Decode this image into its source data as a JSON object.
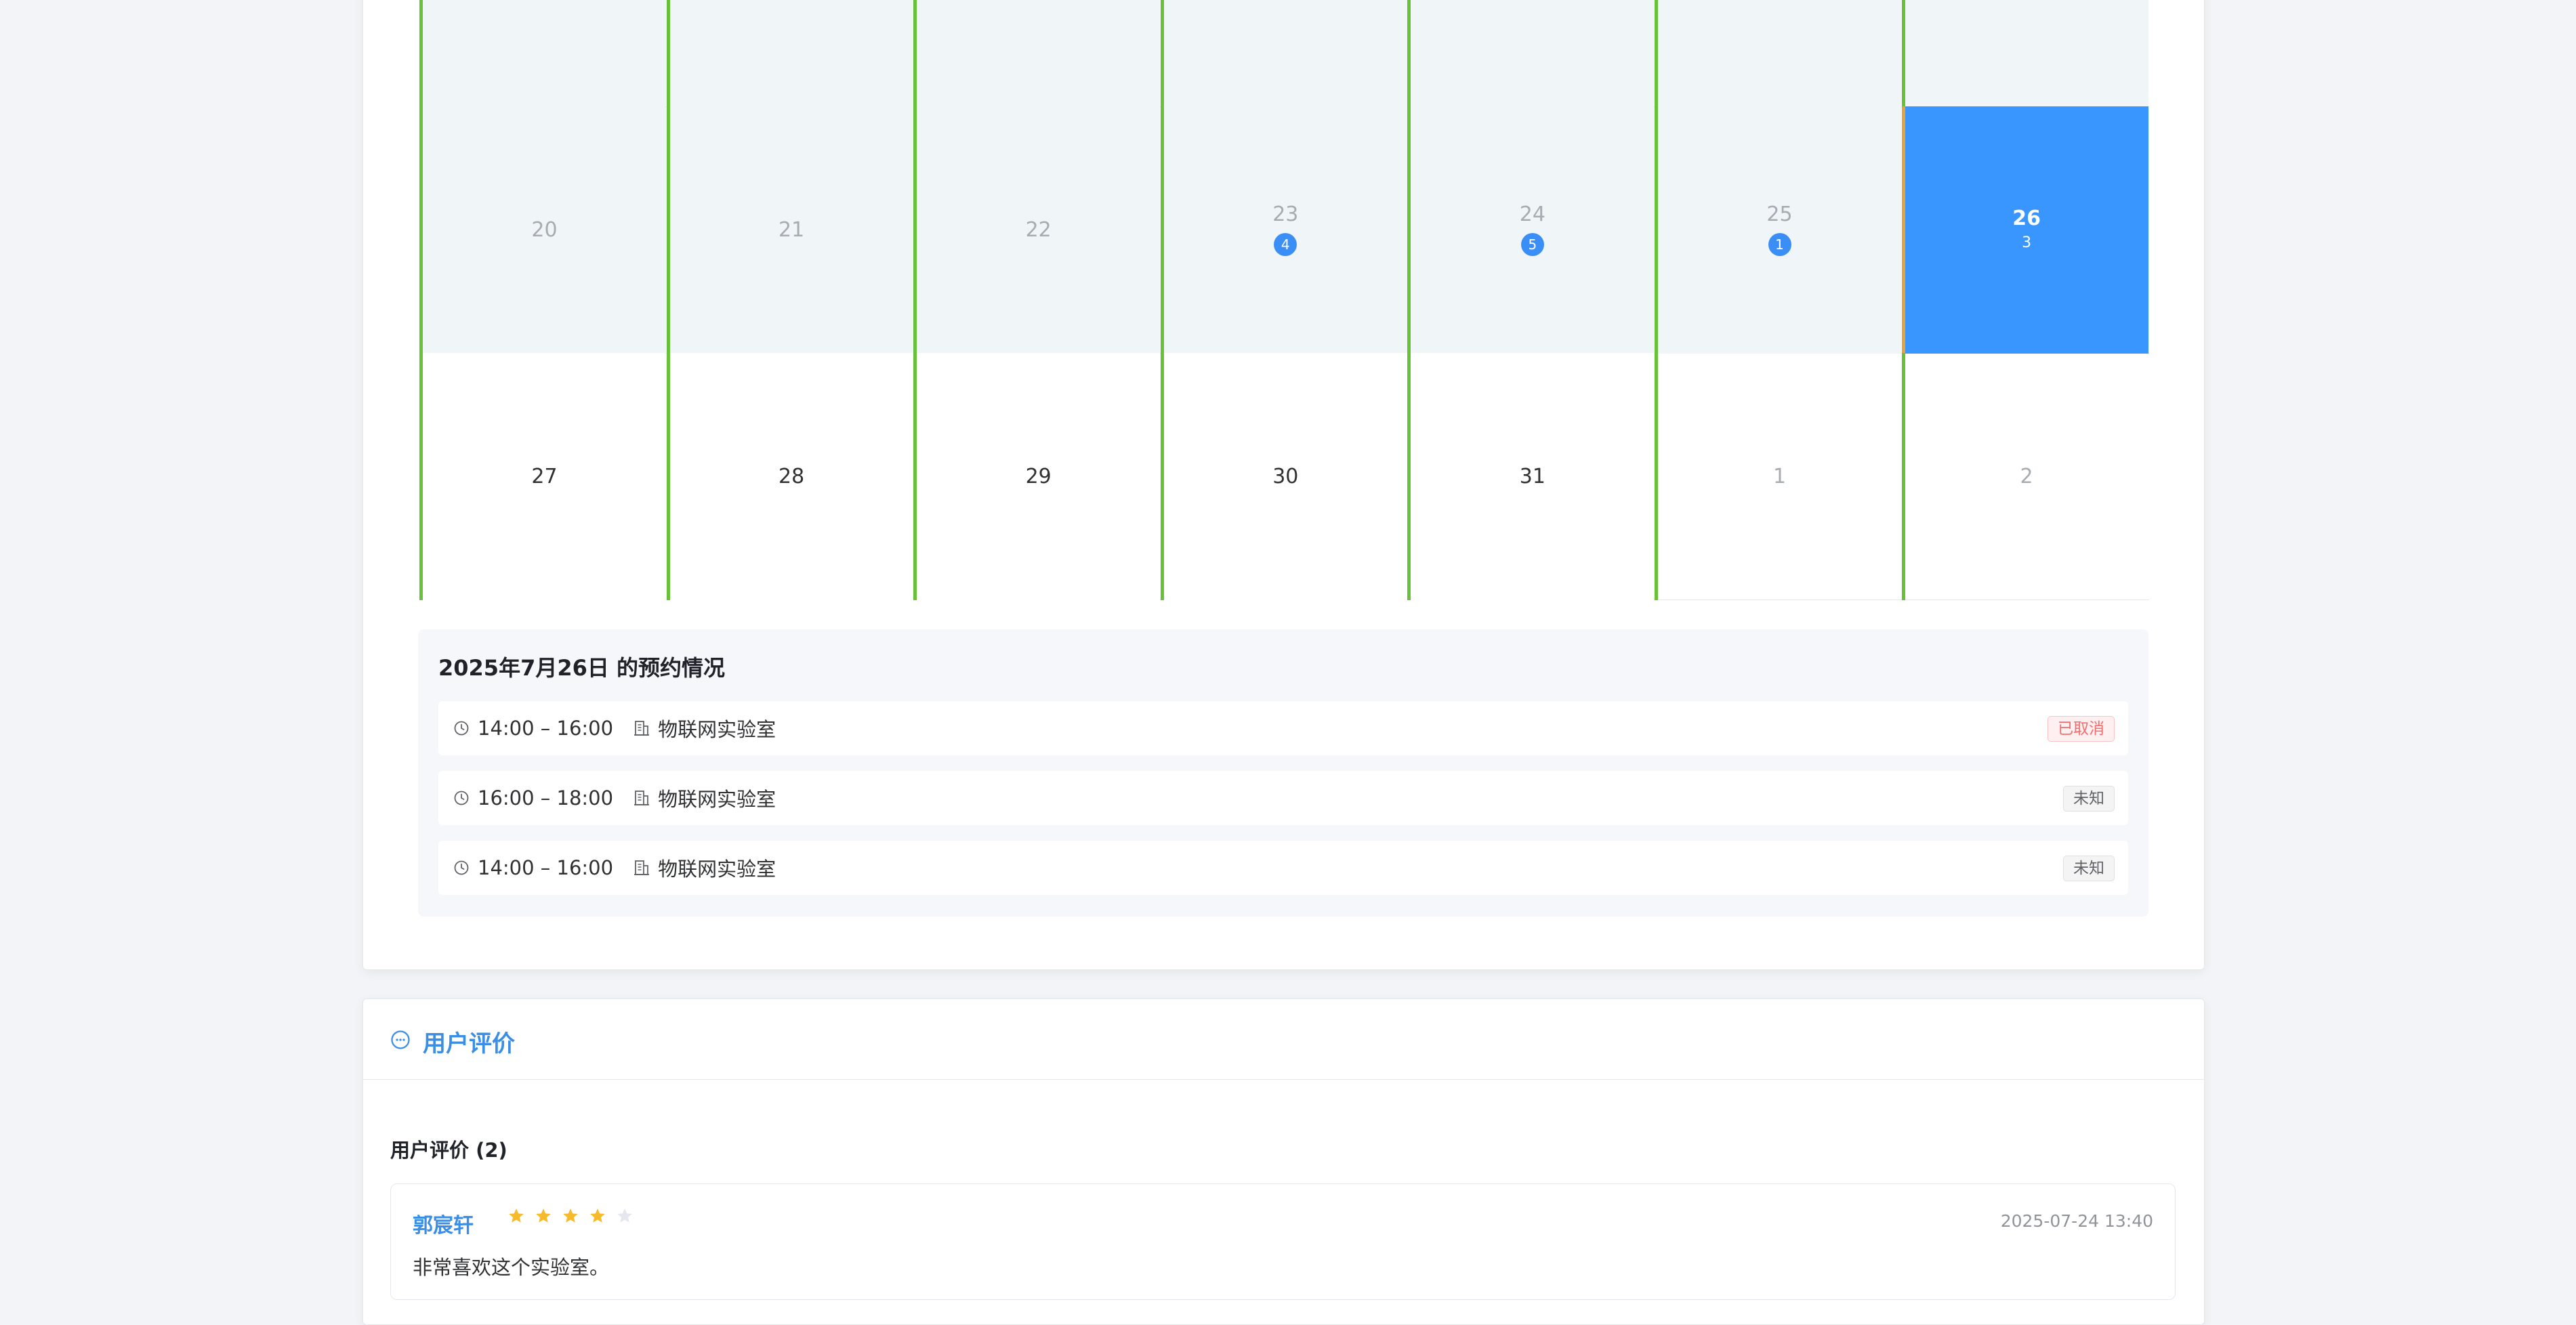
{
  "calendar": {
    "rows": [
      {
        "cells": [
          {
            "day": "",
            "kind": "prev",
            "count": ""
          },
          {
            "day": "",
            "kind": "prev",
            "count": ""
          },
          {
            "day": "",
            "kind": "prev",
            "count": ""
          },
          {
            "day": "",
            "kind": "prev",
            "count": ""
          },
          {
            "day": "",
            "kind": "prev",
            "count": ""
          },
          {
            "day": "",
            "kind": "prev",
            "count": ""
          },
          {
            "day": "",
            "kind": "prev",
            "count": ""
          }
        ]
      },
      {
        "cells": [
          {
            "day": "20",
            "kind": "prev",
            "count": ""
          },
          {
            "day": "21",
            "kind": "prev",
            "count": ""
          },
          {
            "day": "22",
            "kind": "prev",
            "count": ""
          },
          {
            "day": "23",
            "kind": "prev",
            "count": "4"
          },
          {
            "day": "24",
            "kind": "prev",
            "count": "5"
          },
          {
            "day": "25",
            "kind": "prev",
            "count": "1"
          },
          {
            "day": "26",
            "kind": "selected",
            "count": "3"
          }
        ]
      },
      {
        "cells": [
          {
            "day": "27",
            "kind": "cur",
            "count": ""
          },
          {
            "day": "28",
            "kind": "cur",
            "count": ""
          },
          {
            "day": "29",
            "kind": "cur",
            "count": ""
          },
          {
            "day": "30",
            "kind": "cur",
            "count": ""
          },
          {
            "day": "31",
            "kind": "cur",
            "count": ""
          },
          {
            "day": "1",
            "kind": "next",
            "count": ""
          },
          {
            "day": "2",
            "kind": "next",
            "count": ""
          }
        ]
      }
    ]
  },
  "bookings": {
    "title": "2025年7月26日 的预约情况",
    "items": [
      {
        "time": "14:00 – 16:00",
        "room": "物联网实验室",
        "status": "已取消",
        "status_type": "cancelled"
      },
      {
        "time": "16:00 – 18:00",
        "room": "物联网实验室",
        "status": "未知",
        "status_type": "unknown"
      },
      {
        "time": "14:00 – 16:00",
        "room": "物联网实验室",
        "status": "未知",
        "status_type": "unknown"
      }
    ]
  },
  "reviews": {
    "section_title": "用户评价",
    "count_label": "用户评价 (2)",
    "items": [
      {
        "author": "郭宸轩",
        "rating": 4,
        "max_rating": 5,
        "time": "2025-07-24 13:40",
        "text": "非常喜欢这个实验室。"
      }
    ]
  },
  "colors": {
    "accent": "#3a8ee6",
    "selected_day": "#3a96ff",
    "cell_border": "#67c23a",
    "star_on": "#f7ba2a",
    "star_off": "#e4e7ed"
  }
}
